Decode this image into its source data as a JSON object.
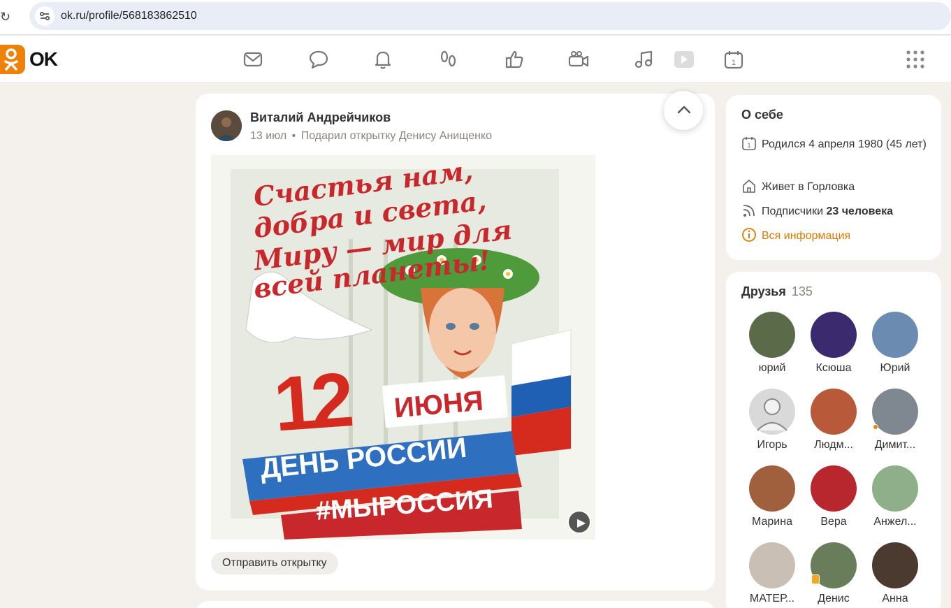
{
  "browser": {
    "url": "ok.ru/profile/568183862510"
  },
  "header": {
    "logo_text": "OK",
    "brand_color": "#ee8208",
    "nav_icons": [
      "mail-icon",
      "chat-icon",
      "bell-icon",
      "footprints-icon",
      "like-icon",
      "video-camera-icon",
      "music-icon",
      "play-icon",
      "calendar-icon"
    ],
    "apps_icon": "apps-grid-icon"
  },
  "post": {
    "author": "Виталий Андрейчиков",
    "date": "13 июл",
    "separator": "•",
    "action": "Подарил открытку Денису Анищенко",
    "postcard_lines": [
      "Счастья нам,",
      "добра и света,",
      "Миру — мир для",
      "всей планеты!"
    ],
    "postcard_day": "12",
    "postcard_month": "ИЮНЯ",
    "postcard_banner": "ДЕНЬ РОССИИ",
    "postcard_tag": "#МЫРОССИЯ",
    "send_button": "Отправить открытку"
  },
  "about": {
    "title": "О себе",
    "birthday": "Родился 4 апреля 1980 (45 лет)",
    "lives": "Живет в Горловка",
    "subscribers_label": "Подписчики",
    "subscribers_value": "23 человека",
    "all_info": "Вся информация"
  },
  "friends": {
    "title": "Друзья",
    "count": "135",
    "items": [
      {
        "name": "юрий",
        "color": "#5b6b4a"
      },
      {
        "name": "Ксюша",
        "color": "#3c2a6e"
      },
      {
        "name": "Юрий",
        "color": "#6b8cb0"
      },
      {
        "name": "Игорь",
        "color": "#d9d9d9"
      },
      {
        "name": "Людм...",
        "color": "#b8593a"
      },
      {
        "name": "Димит...",
        "color": "#7f8790"
      },
      {
        "name": "Марина",
        "color": "#a0603e"
      },
      {
        "name": "Вера",
        "color": "#b8262e"
      },
      {
        "name": "Анжел...",
        "color": "#8fae8a"
      },
      {
        "name": "МАТЕР...",
        "color": "#c9bfb5"
      },
      {
        "name": "Денис",
        "color": "#6a7d5a"
      },
      {
        "name": "Анна",
        "color": "#4a3a30"
      }
    ]
  }
}
